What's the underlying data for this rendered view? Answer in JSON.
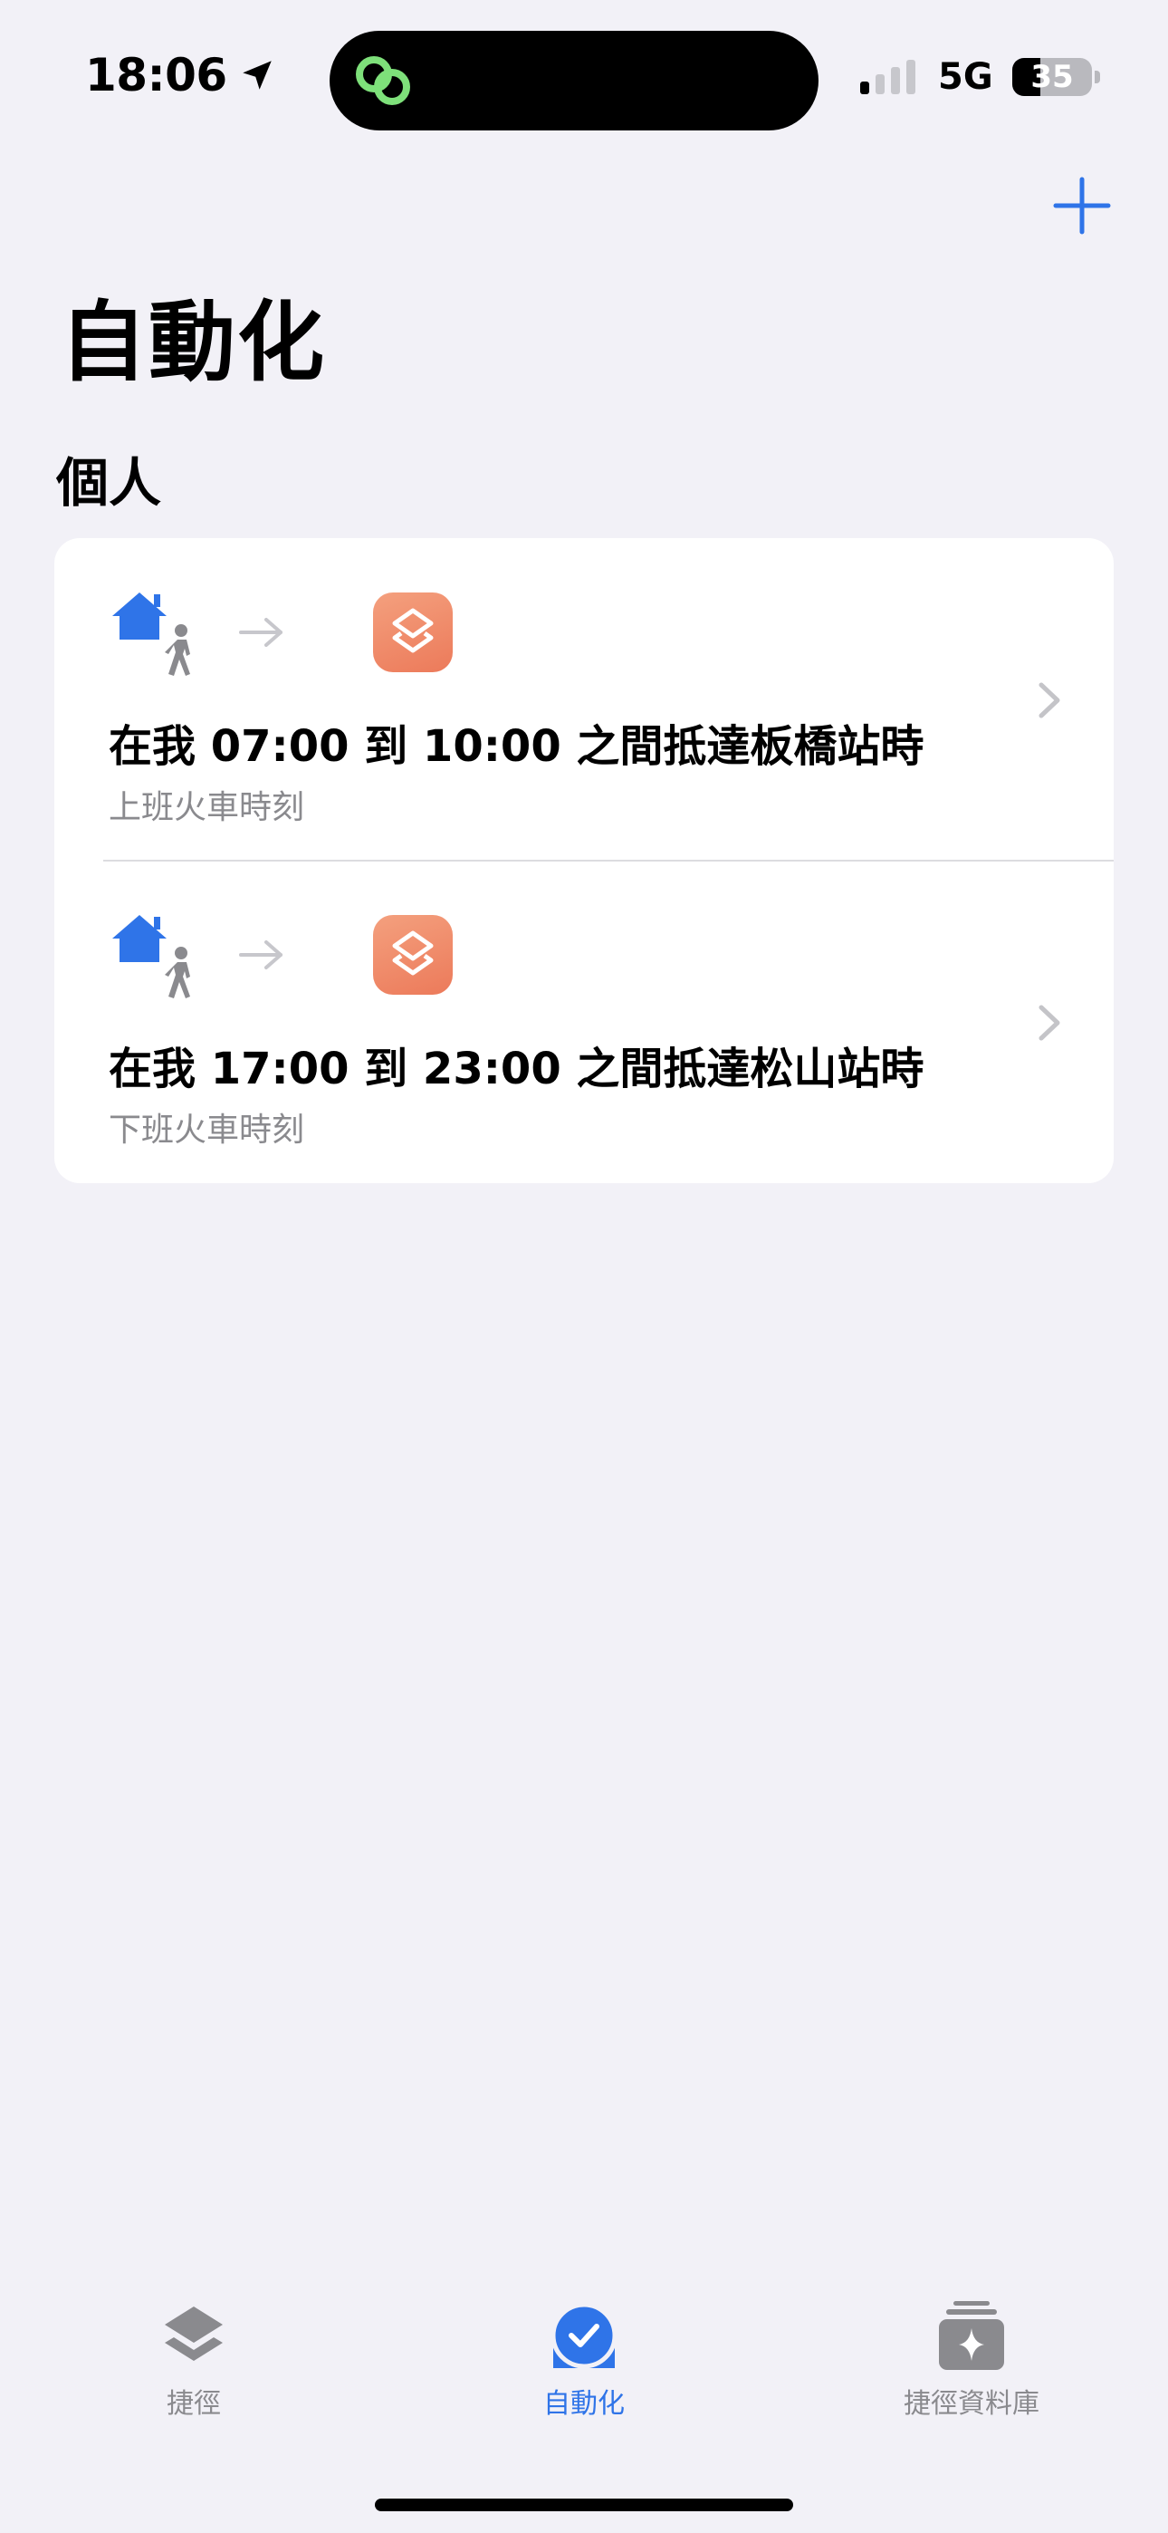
{
  "status_bar": {
    "time": "18:06",
    "network": "5G",
    "battery_percent": "35",
    "signal_bars_active": 1,
    "signal_bars_total": 4
  },
  "header": {
    "add_icon": "plus-icon",
    "title": "自動化"
  },
  "section": {
    "title": "個人"
  },
  "automations": [
    {
      "title": "在我 07:00 到 10:00 之間抵達板橋站時",
      "subtitle": "上班火車時刻",
      "trigger_icon": "home-person-icon",
      "action_icon": "shortcuts-app-icon"
    },
    {
      "title": "在我 17:00 到 23:00 之間抵達松山站時",
      "subtitle": "下班火車時刻",
      "trigger_icon": "home-person-icon",
      "action_icon": "shortcuts-app-icon"
    }
  ],
  "tab_bar": {
    "tabs": [
      {
        "label": "捷徑",
        "icon": "shortcuts-stack-icon",
        "active": false
      },
      {
        "label": "自動化",
        "icon": "automation-check-icon",
        "active": true
      },
      {
        "label": "捷徑資料庫",
        "icon": "gallery-sparkle-icon",
        "active": false
      }
    ]
  },
  "colors": {
    "accent": "#2f74e8",
    "background": "#f2f1f7",
    "shortcut_tile": "#ef8a6a",
    "secondary_text": "#8a8a8e"
  }
}
